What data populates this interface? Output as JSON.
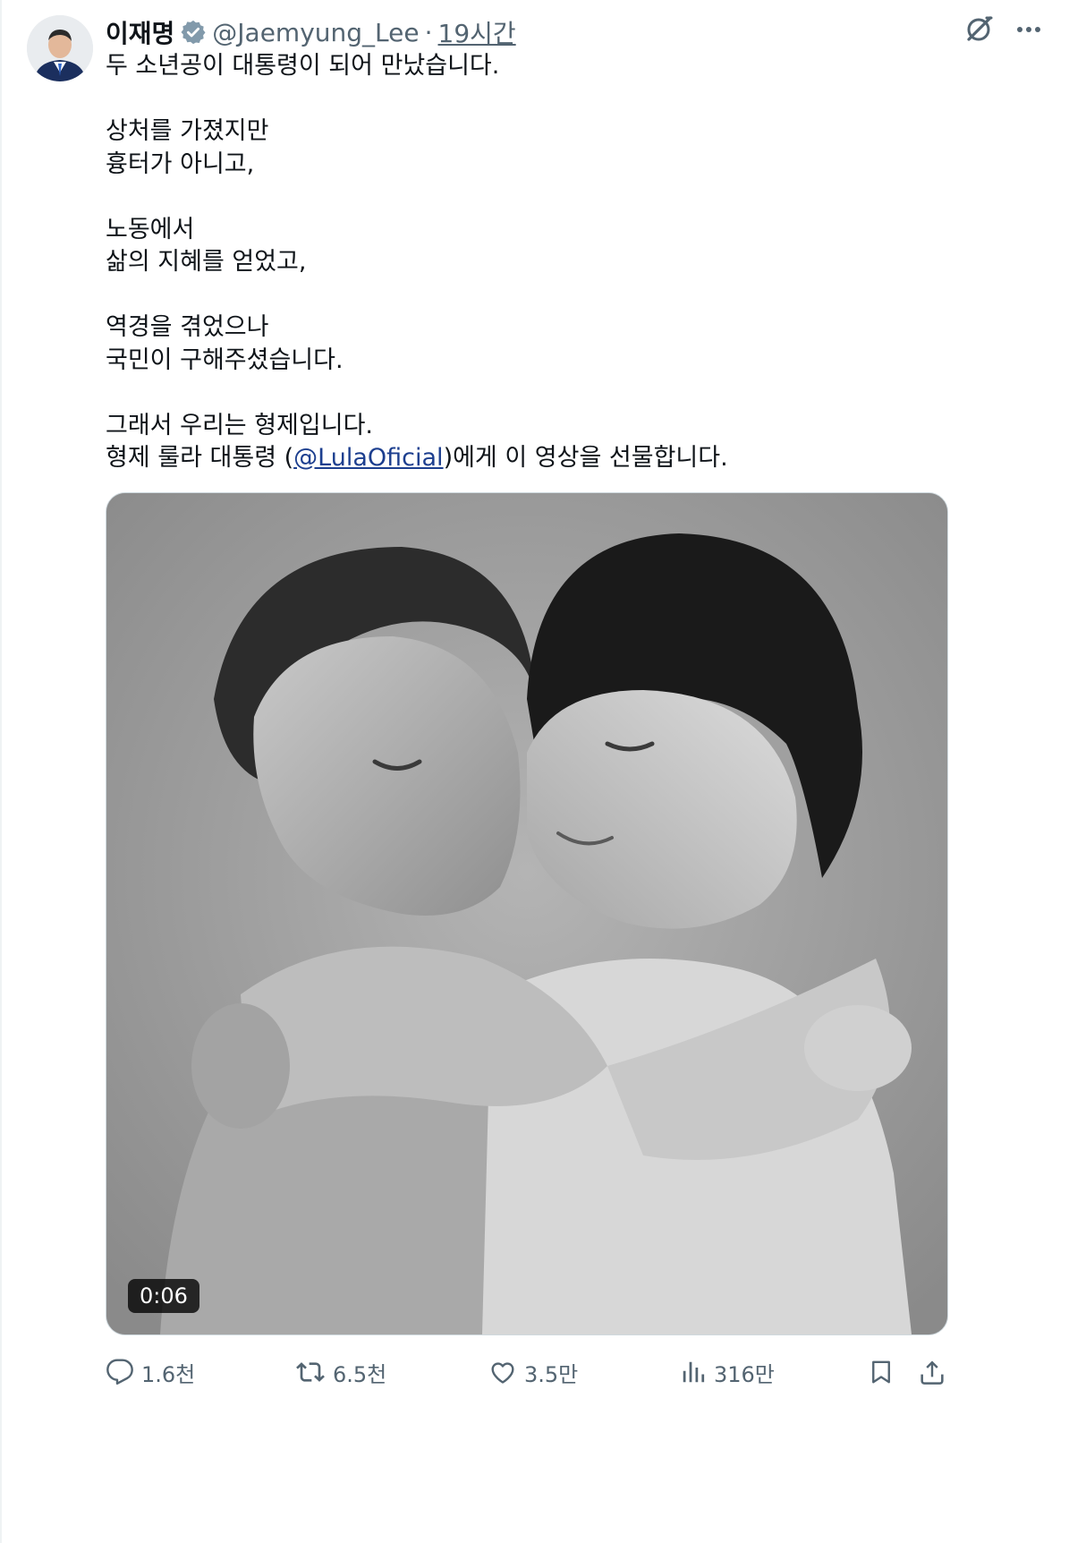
{
  "tweet": {
    "display_name": "이재명",
    "handle": "@Jaemyung_Lee",
    "separator": "·",
    "time": "19시간",
    "avatar": "avatar",
    "verified_icon": "verified-badge-icon",
    "grok_icon": "grok-icon",
    "more_icon": "more-icon",
    "lines": [
      "두 소년공이 대통령이 되어 만났습니다.",
      "",
      "상처를 가졌지만",
      "흉터가 아니고,",
      "",
      "노동에서",
      "삶의 지혜를 얻었고,",
      "",
      "역경을 겪었으나",
      "국민이 구해주셨습니다.",
      "",
      "그래서 우리는 형제입니다."
    ],
    "last_line": {
      "before": "형제 룰라 대통령 (",
      "mention": "@LulaOficial",
      "after": ")에게 이 영상을 선물합니다."
    },
    "media": {
      "description_icon": "video-thumbnail",
      "duration": "0:06"
    },
    "actions": {
      "reply_count": "1.6천",
      "retweet_count": "6.5천",
      "like_count": "3.5만",
      "views_count": "316만"
    },
    "colors": {
      "text": "#0f1419",
      "secondary": "#536471",
      "mention": "#1d3f8f",
      "verified": "#829aab"
    }
  }
}
